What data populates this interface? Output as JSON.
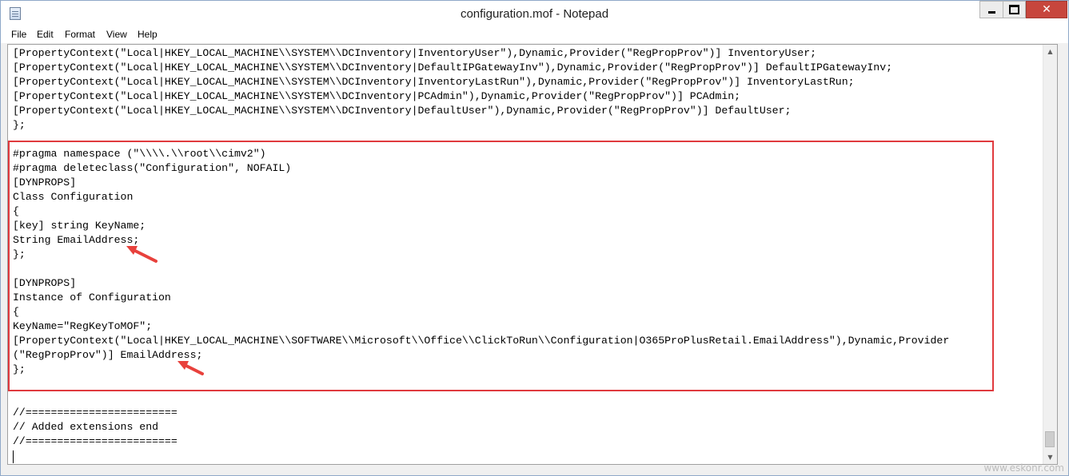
{
  "window": {
    "title": "configuration.mof - Notepad",
    "close_glyph": "✕"
  },
  "menu": {
    "items": [
      "File",
      "Edit",
      "Format",
      "View",
      "Help"
    ]
  },
  "editor": {
    "lines": [
      "[PropertyContext(\"Local|HKEY_LOCAL_MACHINE\\\\SYSTEM\\\\DCInventory|InventoryUser\"),Dynamic,Provider(\"RegPropProv\")] InventoryUser;",
      "[PropertyContext(\"Local|HKEY_LOCAL_MACHINE\\\\SYSTEM\\\\DCInventory|DefaultIPGatewayInv\"),Dynamic,Provider(\"RegPropProv\")] DefaultIPGatewayInv;",
      "[PropertyContext(\"Local|HKEY_LOCAL_MACHINE\\\\SYSTEM\\\\DCInventory|InventoryLastRun\"),Dynamic,Provider(\"RegPropProv\")] InventoryLastRun;",
      "[PropertyContext(\"Local|HKEY_LOCAL_MACHINE\\\\SYSTEM\\\\DCInventory|PCAdmin\"),Dynamic,Provider(\"RegPropProv\")] PCAdmin;",
      "[PropertyContext(\"Local|HKEY_LOCAL_MACHINE\\\\SYSTEM\\\\DCInventory|DefaultUser\"),Dynamic,Provider(\"RegPropProv\")] DefaultUser;",
      "};",
      "",
      "#pragma namespace (\"\\\\\\\\.\\\\root\\\\cimv2\")",
      "#pragma deleteclass(\"Configuration\", NOFAIL)",
      "[DYNPROPS]",
      "Class Configuration",
      "{",
      "[key] string KeyName;",
      "String EmailAddress;",
      "};",
      "",
      "[DYNPROPS]",
      "Instance of Configuration",
      "{",
      "KeyName=\"RegKeyToMOF\";",
      "[PropertyContext(\"Local|HKEY_LOCAL_MACHINE\\\\SOFTWARE\\\\Microsoft\\\\Office\\\\ClickToRun\\\\Configuration|O365ProPlusRetail.EmailAddress\"),Dynamic,Provider",
      "(\"RegPropProv\")] EmailAddress;",
      "};",
      "",
      "",
      "//========================",
      "// Added extensions end",
      "//========================",
      ""
    ]
  },
  "scrollbar": {
    "up_glyph": "▲",
    "down_glyph": "▼"
  },
  "watermark": "www.eskonr.com",
  "colors": {
    "highlight": "#e03a3e",
    "arrow": "#e8413c",
    "close_button": "#c7463d"
  }
}
